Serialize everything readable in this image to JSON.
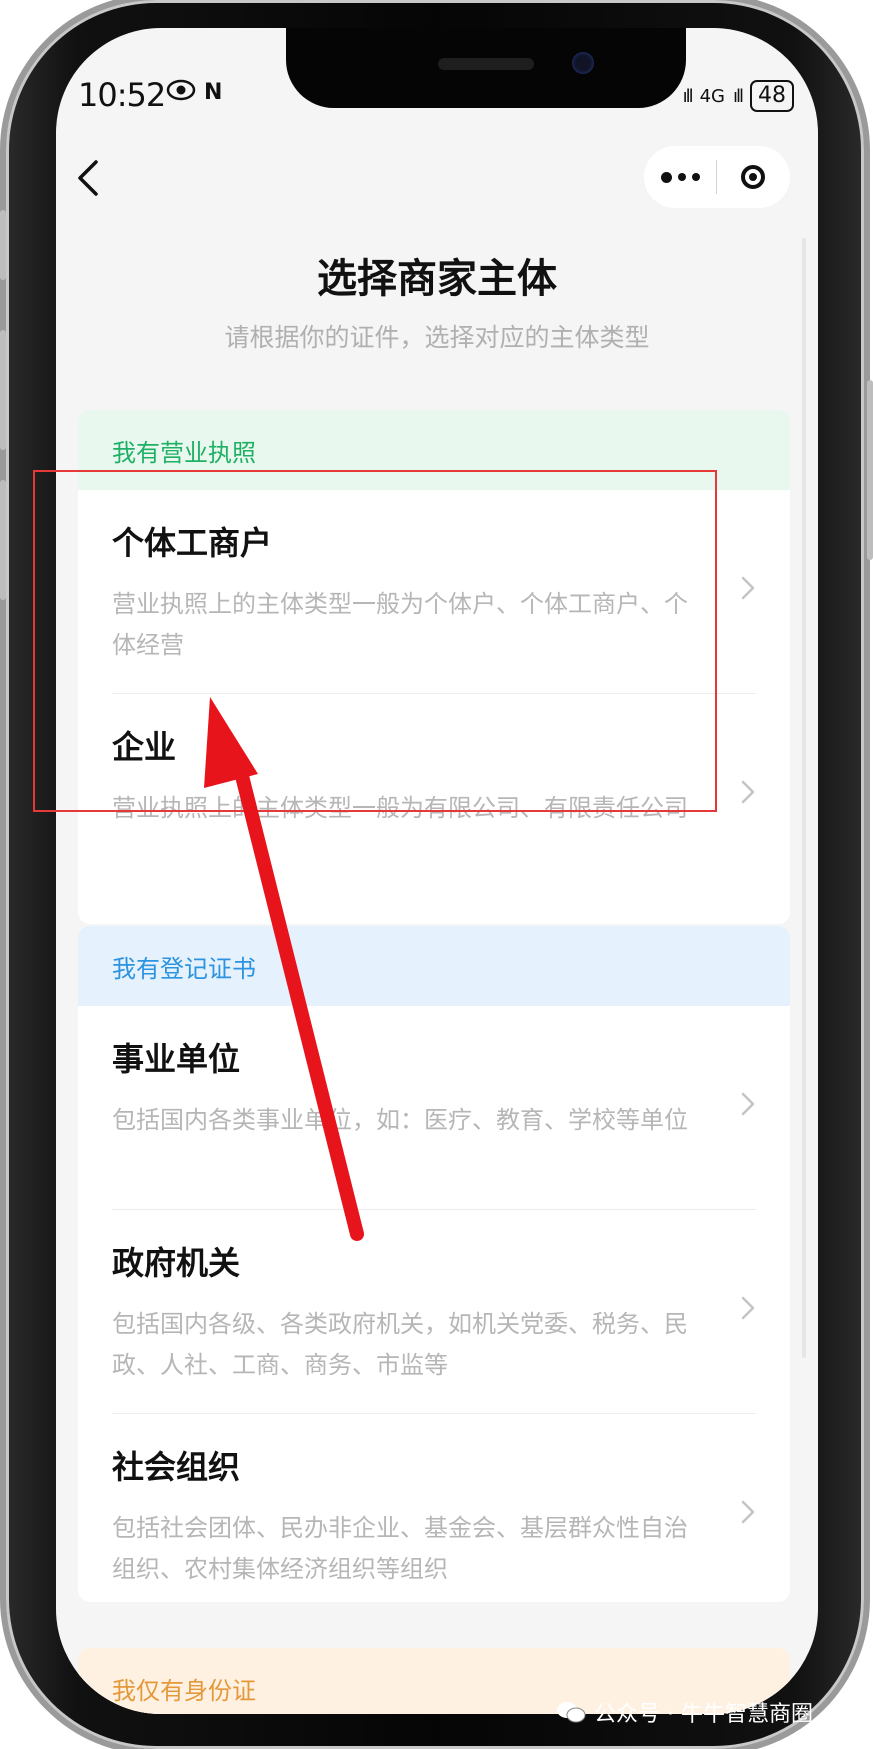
{
  "status_bar": {
    "time": "10:52",
    "nfc": "N",
    "signal_1": "ıll",
    "network": "4G",
    "signal_2": "ıll",
    "battery": "48"
  },
  "nav": {
    "back_icon": "chevron-left-icon",
    "more_icon": "more-dots-icon",
    "close_icon": "target-close-icon"
  },
  "page": {
    "title": "选择商家主体",
    "subtitle": "请根据你的证件，选择对应的主体类型"
  },
  "sections": [
    {
      "header": "我有营业执照",
      "header_color": "#20b065",
      "options": [
        {
          "title": "个体工商户",
          "desc": "营业执照上的主体类型一般为个体户、个体工商户、个体经营"
        },
        {
          "title": "企业",
          "desc": "营业执照上的主体类型一般为有限公司、有限责任公司"
        }
      ]
    },
    {
      "header": "我有登记证书",
      "header_color": "#2c93e0",
      "options": [
        {
          "title": "事业单位",
          "desc": "包括国内各类事业单位，如：医疗、教育、学校等单位"
        },
        {
          "title": "政府机关",
          "desc": "包括国内各级、各类政府机关，如机关党委、税务、民政、人社、工商、商务、市监等"
        },
        {
          "title": "社会组织",
          "desc": "包括社会团体、民办非企业、基金会、基层群众性自治组织、农村集体经济组织等组织"
        }
      ]
    },
    {
      "header": "我仅有身份证",
      "header_color": "#e3993a"
    }
  ],
  "annotation": {
    "highlight_color": "#e53939",
    "arrow_color": "#e8141c"
  },
  "watermark": {
    "icon": "wechat-icon",
    "text": "公众号 · 牛牛智慧商圈"
  }
}
